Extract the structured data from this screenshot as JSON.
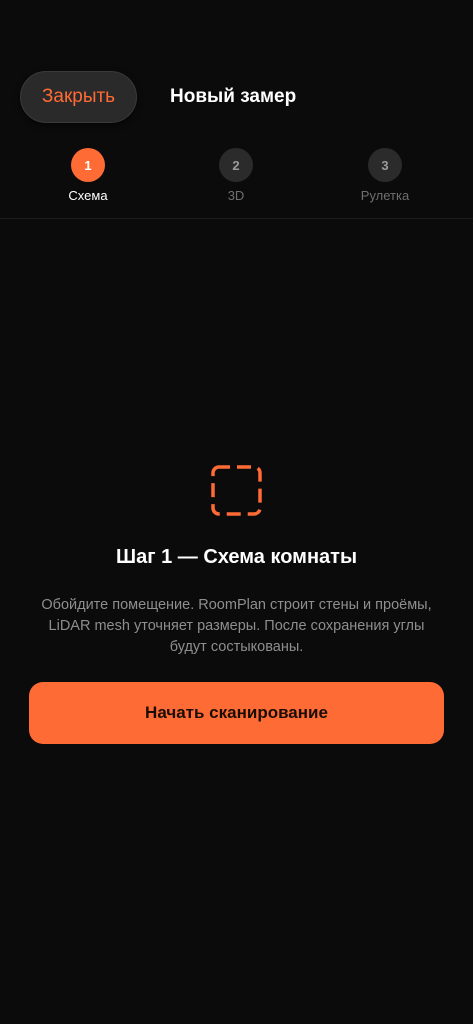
{
  "header": {
    "close_label": "Закрыть",
    "title": "Новый замер"
  },
  "steps": [
    {
      "number": "1",
      "label": "Схема",
      "state": "active"
    },
    {
      "number": "2",
      "label": "3D",
      "state": "inactive"
    },
    {
      "number": "3",
      "label": "Рулетка",
      "state": "inactive"
    }
  ],
  "content": {
    "icon": "dashed-frame-icon",
    "heading": "Шаг 1 — Схема комнаты",
    "description": "Обойдите помещение. RoomPlan строит стены и проёмы, LiDAR mesh уточняет размеры. После сохранения углы будут состыкованы.",
    "start_label": "Начать сканирование"
  },
  "colors": {
    "accent": "#ff6b35",
    "background": "#0b0b0b"
  }
}
